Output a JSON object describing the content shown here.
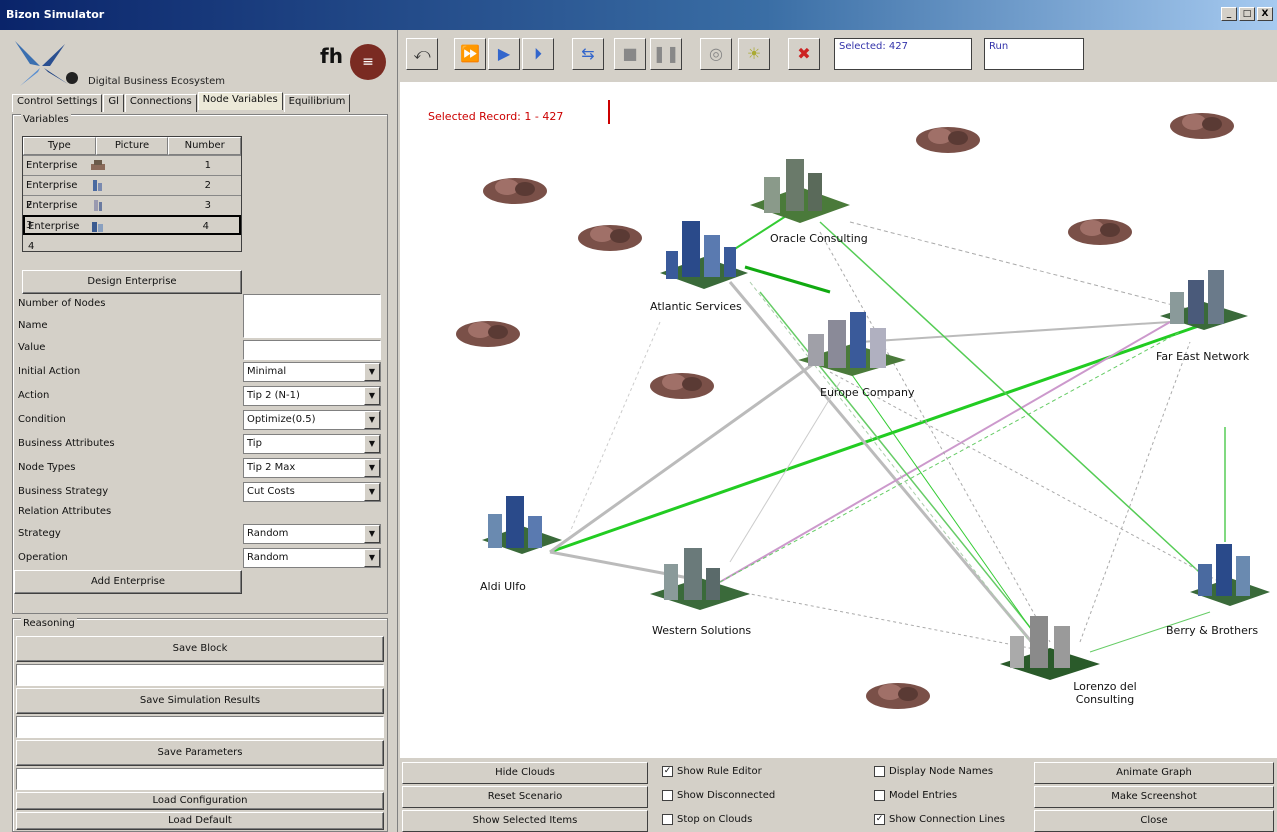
{
  "window": {
    "title": "Bizon Simulator",
    "controls": [
      "_",
      "□",
      "X"
    ]
  },
  "logo": {
    "text": "Digital Business Ecosystem",
    "badge": "fh",
    "circle": "≡"
  },
  "tabs": [
    "Control Settings",
    "Gl",
    "Connections",
    "Node Variables",
    "Equilibrium"
  ],
  "active_tab": "Node Variables",
  "variables": {
    "group_label": "Variables",
    "columns": [
      "Type",
      "Picture",
      "Number"
    ],
    "rows": [
      {
        "type": "Enterprise",
        "number": "1"
      },
      {
        "type": "Enterprise 2",
        "number": "2"
      },
      {
        "type": "Enterprise 3",
        "number": "3"
      },
      {
        "type": "Enterprise 4",
        "number": "4"
      }
    ],
    "design_button": "Design Enterprise",
    "fields": {
      "number_of_nodes": "Number of Nodes",
      "name": "Name",
      "value": "Value",
      "initial_action": "Initial Action",
      "initial_action_val": "Minimal",
      "action": "Action",
      "action_val": "Tip 2 (N-1)",
      "condition": "Condition",
      "condition_val": "Optimize(0.5)",
      "business_attributes": "Business Attributes",
      "business_attributes_val": "Tip",
      "node_types": "Node Types",
      "node_types_val": "Tip 2 Max",
      "strategy": "Business Strategy",
      "strategy_val": "Cut Costs",
      "relation_attributes": "Relation Attributes",
      "strategy_2": "Strategy",
      "strategy_2_val": "Random",
      "operation": "Operation",
      "operation_val": "Random"
    },
    "add_button": "Add Enterprise"
  },
  "reasoning": {
    "group_label": "Reasoning",
    "buttons": [
      "Save Block",
      "Save Simulation Results",
      "Save Parameters",
      "Load Configuration",
      "Load Default"
    ],
    "fields": [
      "",
      "",
      ""
    ]
  },
  "toolbar": {
    "buttons": [
      "back-icon",
      "fast-forward-icon",
      "play-icon",
      "step-icon",
      "shuffle-icon",
      "stop-icon",
      "pause-icon",
      "target-icon",
      "bulb-icon",
      "delete-icon"
    ],
    "field1": "Selected: 427",
    "field2": "Run"
  },
  "canvas": {
    "selected_record": "Selected Record: 1 - 427",
    "nodes": [
      {
        "label": ""
      },
      {
        "label": "Oracle Consulting"
      },
      {
        "label": "Atlantic Services"
      },
      {
        "label": "Europe Company"
      },
      {
        "label": "Far East Network"
      },
      {
        "label": "Aldi Ulfo"
      },
      {
        "label": "Western Solutions"
      },
      {
        "label": "Lorenzo del Consulting"
      },
      {
        "label": "Berry & Brothers"
      }
    ]
  },
  "bottom": {
    "buttons_left": [
      "Hide Clouds",
      "Reset Scenario",
      "Show Selected Items"
    ],
    "checkboxes_col1": [
      {
        "label": "Show Rule Editor",
        "checked": true
      },
      {
        "label": "Show Disconnected",
        "checked": false
      },
      {
        "label": "Stop on Clouds",
        "checked": false
      }
    ],
    "checkboxes_col2": [
      {
        "label": "Display Node Names",
        "checked": false
      },
      {
        "label": "Model Entries",
        "checked": false
      },
      {
        "label": "Show Connection Lines",
        "checked": true
      }
    ],
    "buttons_right": [
      "Animate Graph",
      "Make Screenshot",
      "Close"
    ]
  }
}
